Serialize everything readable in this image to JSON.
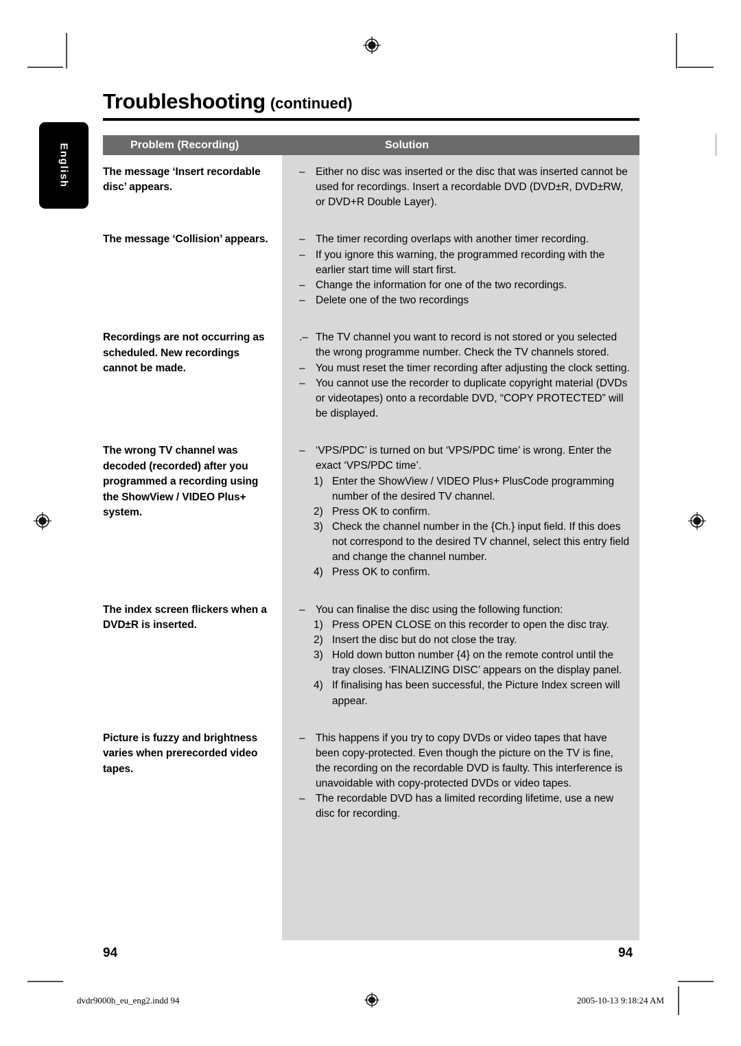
{
  "page": {
    "title_main": "Troubleshooting",
    "title_sub": "(continued)",
    "language_tab": "English",
    "folio_left": "94",
    "folio_right": "94"
  },
  "table": {
    "header": {
      "problem": "Problem (Recording)",
      "solution": "Solution"
    },
    "rows": [
      {
        "problem": "The message ‘Insert recordable disc’ appears.",
        "bullets": [
          {
            "marker": "–",
            "text": "Either no disc was inserted or the disc that was inserted cannot be used for recordings. Insert a recordable DVD (DVD±R, DVD±RW, or DVD+R Double Layer)."
          }
        ],
        "steps": []
      },
      {
        "problem": "The message ‘Collision’ appears.",
        "bullets": [
          {
            "marker": "–",
            "text": "The timer recording overlaps with another timer recording."
          },
          {
            "marker": "–",
            "text": "If you ignore this warning, the programmed recording with the earlier start time will start first."
          },
          {
            "marker": "–",
            "text": "Change the information for one of the two recordings."
          },
          {
            "marker": "–",
            "text": "Delete one of the two recordings"
          }
        ],
        "steps": []
      },
      {
        "problem": "Recordings are not occurring as scheduled. New recordings cannot be made.",
        "bullets": [
          {
            "marker": ".–",
            "text": "The TV channel you want to record is not stored or you selected the wrong programme number. Check the TV channels stored."
          },
          {
            "marker": "–",
            "text": "You must reset the timer recording after adjusting the clock setting."
          },
          {
            "marker": "–",
            "text": "You cannot use the recorder to duplicate copyright material (DVDs or videotapes) onto a recordable DVD, “COPY PROTECTED” will be displayed."
          }
        ],
        "steps": []
      },
      {
        "problem": "The wrong TV channel was decoded (recorded) after you programmed a recording using the ShowView / VIDEO Plus+ system.",
        "bullets": [
          {
            "marker": "–",
            "text": "‘VPS/PDC’ is turned on but ‘VPS/PDC time’ is wrong. Enter the exact ‘VPS/PDC time’."
          }
        ],
        "steps": [
          {
            "num": "1)",
            "text": "Enter the ShowView / VIDEO Plus+ PlusCode programming number of the desired TV channel."
          },
          {
            "num": "2)",
            "text": "Press OK to confirm."
          },
          {
            "num": "3)",
            "text": "Check the channel number in the {Ch.} input field. If this does not correspond to the desired TV channel, select this entry field and change the channel number."
          },
          {
            "num": "4)",
            "text": "Press OK to confirm."
          }
        ]
      },
      {
        "problem": "The index screen flickers when a DVD±R is inserted.",
        "bullets": [
          {
            "marker": "–",
            "text": "You can finalise the disc using the following function:"
          }
        ],
        "steps": [
          {
            "num": "1)",
            "text": "Press OPEN CLOSE on this recorder to open the disc tray."
          },
          {
            "num": "2)",
            "text": "Insert the disc but do not close the tray."
          },
          {
            "num": "3)",
            "text": "Hold down button number {4} on the remote control until the tray closes. ‘FINALIZING DISC’ appears on the display panel."
          },
          {
            "num": "4)",
            "text": "If finalising has been successful, the Picture Index screen will appear."
          }
        ]
      },
      {
        "problem": "Picture is fuzzy and brightness varies when prerecorded video tapes.",
        "bullets": [
          {
            "marker": "–",
            "text": "This happens if you try to copy DVDs or video tapes that have been copy-protected. Even though the picture on the TV is fine, the recording on the recordable DVD is faulty.  This interference is unavoidable with copy-protected DVDs or video tapes."
          },
          {
            "marker": "–",
            "text": "The recordable DVD has a limited recording lifetime, use a new disc for recording."
          }
        ],
        "steps": []
      }
    ]
  },
  "imprint": {
    "file": "dvdr9000h_eu_eng2.indd   94",
    "date": "2005-10-13   9:18:24 AM"
  },
  "colors": {
    "header_bar": "#6b6b6b",
    "solution_column": "#d8d8d8",
    "tab": "#000000"
  }
}
